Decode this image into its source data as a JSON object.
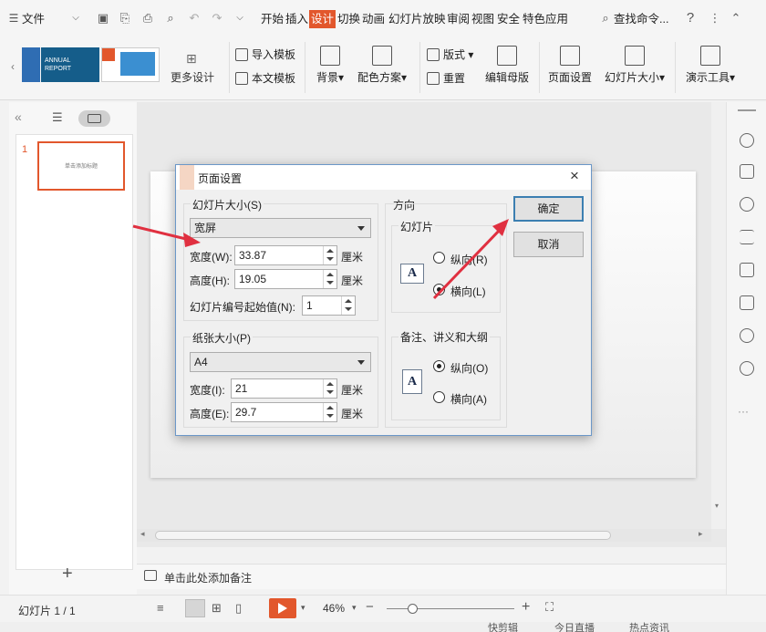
{
  "menubar": {
    "file_label": "文件",
    "tabs": [
      {
        "label": "开始"
      },
      {
        "label": "插入"
      },
      {
        "label": "设计"
      },
      {
        "label": "切换"
      },
      {
        "label": "动画"
      },
      {
        "label": "幻灯片放映"
      },
      {
        "label": "审阅"
      },
      {
        "label": "视图"
      },
      {
        "label": "安全"
      },
      {
        "label": "特色应用"
      }
    ],
    "active_tab": "设计",
    "search_label": "查找命令..."
  },
  "ribbon": {
    "template1_text": "ANNUAL REPORT",
    "more_designs": "更多设计",
    "import_template": "导入模板",
    "text_template": "本文模板",
    "background": "背景",
    "color_scheme": "配色方案",
    "layout": "版式",
    "reset": "重置",
    "edit_master": "编辑母版",
    "page_setup": "页面设置",
    "slide_size": "幻灯片大小",
    "present_tools": "演示工具"
  },
  "slide_panel": {
    "slide_number": "1",
    "thumb_title": "单击添加标题"
  },
  "dialog": {
    "title": "页面设置",
    "slide_size_group": "幻灯片大小(S)",
    "slide_size_value": "宽屏",
    "width_label": "宽度(W):",
    "width_value": "33.87",
    "height_label": "高度(H):",
    "height_value": "19.05",
    "unit": "厘米",
    "start_num_label": "幻灯片编号起始值(N):",
    "start_num_value": "1",
    "paper_group": "纸张大小(P)",
    "paper_value": "A4",
    "paper_width_label": "宽度(I):",
    "paper_width_value": "21",
    "paper_height_label": "高度(E):",
    "paper_height_value": "29.7",
    "orientation_label": "方向",
    "slides_group": "幻灯片",
    "portrait_r": "纵向(R)",
    "landscape_l": "横向(L)",
    "notes_group": "备注、讲义和大纲",
    "portrait_o": "纵向(O)",
    "landscape_a": "横向(A)",
    "ok": "确定",
    "cancel": "取消",
    "icon_letter": "A"
  },
  "notes": {
    "placeholder": "单击此处添加备注"
  },
  "status": {
    "slide_info": "幻灯片 1 / 1",
    "zoom": "46%"
  },
  "taskbar": {
    "item1": "快剪辑",
    "item2": "今日直播",
    "item3": "热点资讯"
  },
  "colors": {
    "accent": "#e2572c",
    "arrow": "#e03040",
    "dialog_border": "#6b97c8"
  }
}
